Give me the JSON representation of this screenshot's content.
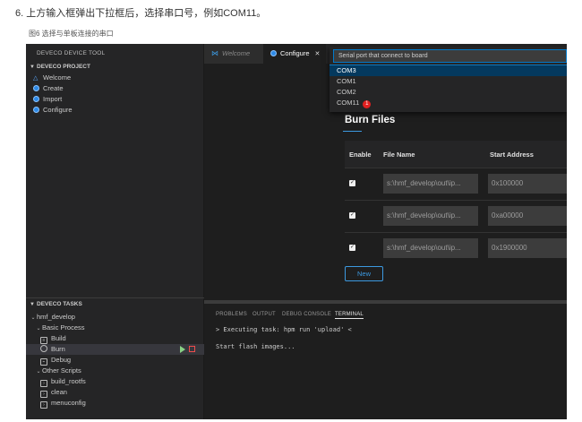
{
  "doc": {
    "step_text": "6. 上方输入框弹出下拉框后，选择串口号，例如COM11。",
    "caption": "图6 选择与单板连接的串口"
  },
  "sidebar": {
    "title": "DEVECO DEVICE TOOL",
    "project_header": "DEVECO PROJECT",
    "project_items": [
      {
        "label": "Welcome",
        "icon": "deveco-logo-icon"
      },
      {
        "label": "Create",
        "icon": "deveco-circle-icon"
      },
      {
        "label": "Import",
        "icon": "deveco-circle-icon"
      },
      {
        "label": "Configure",
        "icon": "deveco-circle-icon"
      }
    ],
    "tasks_header": "DEVECO TASKS",
    "tasks": {
      "project": "hmf_develop",
      "basic_group": "Basic Process",
      "build": "Build",
      "burn": "Burn",
      "debug": "Debug",
      "other_group": "Other Scripts",
      "scripts": [
        "build_rootfs",
        "clean",
        "menuconfig"
      ]
    }
  },
  "tabs": [
    {
      "label": "Welcome",
      "icon": "vscode-icon"
    },
    {
      "label": "Configure",
      "icon": "deveco-circle-icon"
    }
  ],
  "quick_pick": {
    "placeholder": "Serial port that connect to board",
    "options": [
      "COM3",
      "COM1",
      "COM2",
      "COM11"
    ],
    "highlighted": "COM3",
    "badge": "1"
  },
  "burn": {
    "title": "Burn Files",
    "columns": [
      "Enable",
      "File Name",
      "Start Address"
    ],
    "rows": [
      {
        "enabled": true,
        "file": "s:\\hmf_develop\\out\\ip...",
        "address": "0x100000"
      },
      {
        "enabled": true,
        "file": "s:\\hmf_develop\\out\\ip...",
        "address": "0xa00000"
      },
      {
        "enabled": true,
        "file": "s:\\hmf_develop\\out\\ip...",
        "address": "0x1900000"
      }
    ],
    "new_button": "New"
  },
  "panel": {
    "tabs": [
      "PROBLEMS",
      "OUTPUT",
      "DEBUG CONSOLE",
      "TERMINAL"
    ],
    "active_tab": "TERMINAL",
    "lines": [
      "> Executing task: hpm run 'upload' <",
      "Start flash images..."
    ]
  }
}
